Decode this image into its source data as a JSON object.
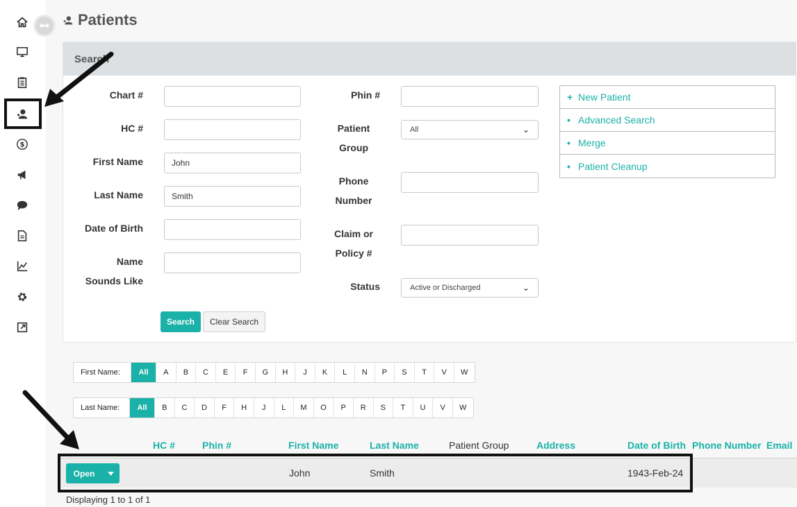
{
  "page": {
    "title": "Patients"
  },
  "search": {
    "header": "Search",
    "fields_left": [
      {
        "label": "Chart #",
        "value": ""
      },
      {
        "label": "HC #",
        "value": ""
      },
      {
        "label": "First Name",
        "value": "John"
      },
      {
        "label": "Last Name",
        "value": "Smith"
      },
      {
        "label": "Date of Birth",
        "value": ""
      },
      {
        "label_line1": "Name",
        "label_line2": "Sounds Like",
        "value": ""
      }
    ],
    "fields_right": {
      "phin": {
        "label": "Phin #",
        "value": ""
      },
      "patient_group": {
        "label_line1": "Patient",
        "label_line2": "Group",
        "value": "All"
      },
      "phone": {
        "label_line1": "Phone",
        "label_line2": "Number",
        "value": ""
      },
      "claim": {
        "label_line1": "Claim or",
        "label_line2": "Policy #",
        "value": ""
      },
      "status": {
        "label": "Status",
        "value": "Active or Discharged"
      }
    },
    "search_label": "Search",
    "clear_label": "Clear Search"
  },
  "actions": [
    {
      "label": "New Patient",
      "icon": "plus-icon"
    },
    {
      "label": "Advanced Search",
      "icon": "bullet-icon"
    },
    {
      "label": "Merge",
      "icon": "bullet-icon"
    },
    {
      "label": "Patient Cleanup",
      "icon": "bullet-icon"
    }
  ],
  "first_name_filter": {
    "label": "First Name:",
    "letters": [
      "All",
      "A",
      "B",
      "C",
      "E",
      "F",
      "G",
      "H",
      "J",
      "K",
      "L",
      "N",
      "P",
      "S",
      "T",
      "V",
      "W"
    ]
  },
  "last_name_filter": {
    "label": "Last Name:",
    "letters": [
      "All",
      "B",
      "C",
      "D",
      "F",
      "H",
      "J",
      "L",
      "M",
      "O",
      "P",
      "R",
      "S",
      "T",
      "U",
      "V",
      "W"
    ]
  },
  "table": {
    "columns": {
      "hc": "HC #",
      "phin": "Phin #",
      "first_name": "First Name",
      "last_name": "Last Name",
      "patient_group": "Patient Group",
      "address": "Address",
      "dob": "Date of Birth",
      "phone": "Phone Number",
      "email": "Email"
    },
    "rows": [
      {
        "open_label": "Open",
        "first_name": "John",
        "last_name": "Smith",
        "dob": "1943-Feb-24"
      }
    ],
    "footer": "Displaying 1 to 1 of 1"
  },
  "colors": {
    "accent": "#1ab1a8",
    "panel_header": "#dde0e3",
    "highlight": "#111111"
  }
}
